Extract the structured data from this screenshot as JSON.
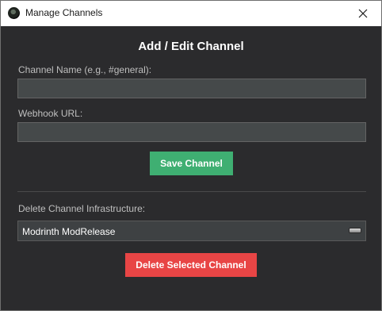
{
  "window": {
    "title": "Manage Channels"
  },
  "form": {
    "heading": "Add / Edit Channel",
    "channel_name_label": "Channel Name (e.g., #general):",
    "channel_name_value": "",
    "webhook_label": "Webhook URL:",
    "webhook_value": "",
    "save_label": "Save Channel"
  },
  "delete_section": {
    "label": "Delete Channel Infrastructure:",
    "selected_channel": "Modrinth ModRelease",
    "delete_label": "Delete Selected Channel"
  },
  "colors": {
    "background": "#2b2b2d",
    "save_button": "#3faf72",
    "delete_button": "#e84545",
    "input_background": "#45494a"
  },
  "icons": {
    "app": "app-logo-icon",
    "close": "close-icon",
    "dropdown": "dropdown-arrow-icon"
  }
}
